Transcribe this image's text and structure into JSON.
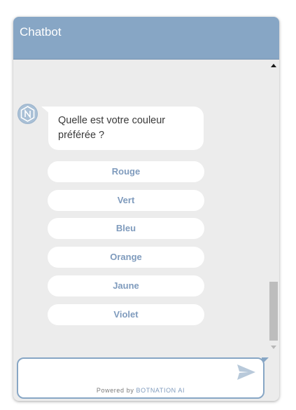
{
  "header": {
    "title": "Chatbot"
  },
  "bot": {
    "avatar_icon": "botnation-n-icon",
    "message": "Quelle est votre couleur préférée ?"
  },
  "quick_replies": [
    "Rouge",
    "Vert",
    "Bleu",
    "Orange",
    "Jaune",
    "Violet"
  ],
  "composer": {
    "placeholder": "",
    "value": "",
    "send_icon": "paper-plane-icon"
  },
  "footer": {
    "powered_prefix": "Powered by",
    "brand": "BOTNATION",
    "brand_suffix": "AI"
  },
  "colors": {
    "header": "#87a6c5",
    "background": "#ececec",
    "accent_text": "#7f9bbd"
  }
}
